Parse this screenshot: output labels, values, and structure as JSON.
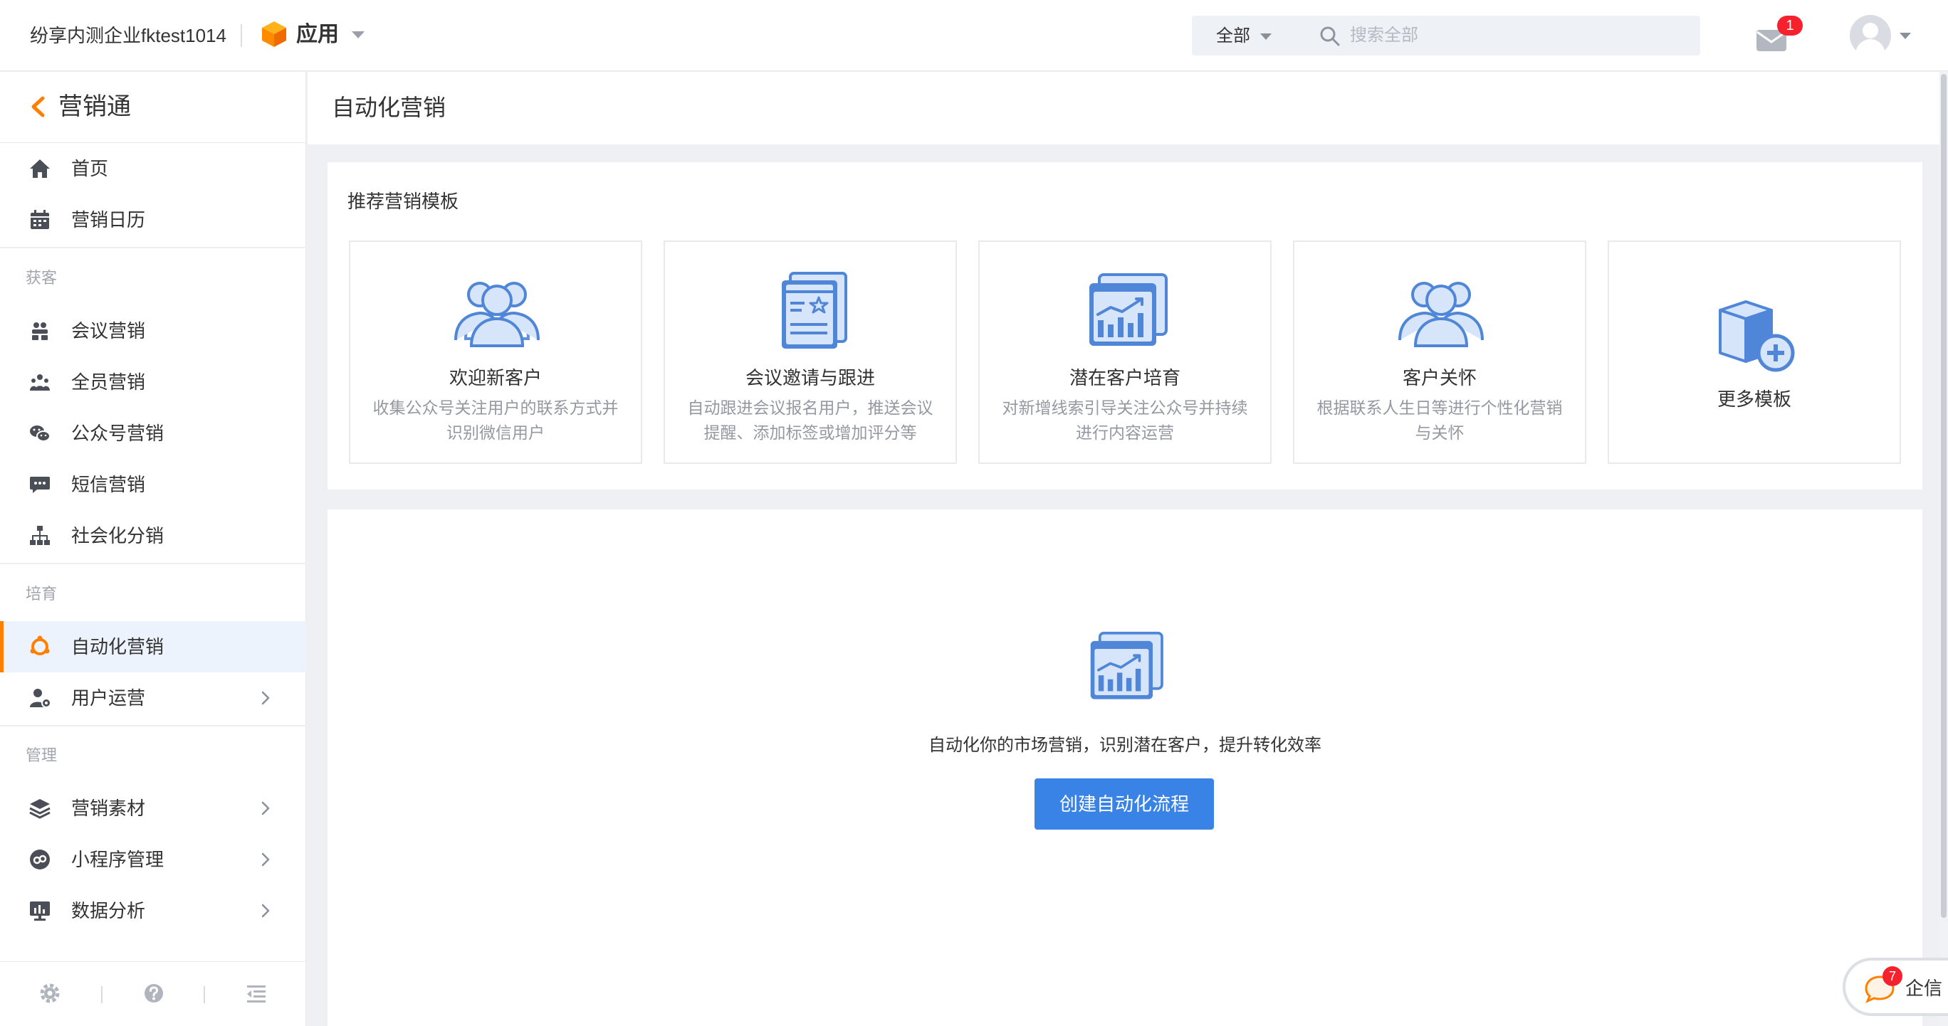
{
  "topbar": {
    "company": "纷享内测企业fktest1014",
    "app_label": "应用",
    "search_scope": "全部",
    "search_placeholder": "搜索全部",
    "mail_badge": "1"
  },
  "sidebar": {
    "title": "营销通",
    "groups": [
      "获客",
      "培育",
      "管理"
    ],
    "items": [
      {
        "label": "首页",
        "icon": "home-icon"
      },
      {
        "label": "营销日历",
        "icon": "calendar-icon"
      },
      {
        "label": "会议营销",
        "icon": "meeting-icon"
      },
      {
        "label": "全员营销",
        "icon": "team-icon"
      },
      {
        "label": "公众号营销",
        "icon": "wechat-icon"
      },
      {
        "label": "短信营销",
        "icon": "sms-icon"
      },
      {
        "label": "社会化分销",
        "icon": "distribution-icon"
      },
      {
        "label": "自动化营销",
        "icon": "automation-icon",
        "active": true
      },
      {
        "label": "用户运营",
        "icon": "user-ops-icon",
        "has_children": true
      },
      {
        "label": "营销素材",
        "icon": "layers-icon",
        "has_children": true
      },
      {
        "label": "小程序管理",
        "icon": "miniprogram-icon",
        "has_children": true
      },
      {
        "label": "数据分析",
        "icon": "analytics-icon",
        "has_children": true
      }
    ],
    "footer_icons": [
      "settings-icon",
      "help-icon",
      "collapse-menu-icon"
    ]
  },
  "page": {
    "title": "自动化营销"
  },
  "templates": {
    "title": "推荐营销模板",
    "cards": [
      {
        "name": "欢迎新客户",
        "desc": "收集公众号关注用户的联系方式并识别微信用户",
        "icon": "users-icon"
      },
      {
        "name": "会议邀请与跟进",
        "desc": "自动跟进会议报名用户，推送会议提醒、添加标签或增加评分等",
        "icon": "invitation-card-icon"
      },
      {
        "name": "潜在客户培育",
        "desc": "对新增线索引导关注公众号并持续进行内容运营",
        "icon": "chart-board-icon"
      },
      {
        "name": "客户关怀",
        "desc": "根据联系人生日等进行个性化营销与关怀",
        "icon": "users-icon"
      },
      {
        "name": "更多模板",
        "icon": "box-plus-icon"
      }
    ]
  },
  "empty_state": {
    "text": "自动化你的市场营销，识别潜在客户，提升转化效率",
    "button": "创建自动化流程"
  },
  "chat": {
    "label": "企信",
    "badge": "7"
  },
  "colors": {
    "accent_orange": "#ff8000",
    "primary_blue": "#3a83e6",
    "icon_blue": "#4f86d8",
    "badge_red": "#f5222d"
  }
}
